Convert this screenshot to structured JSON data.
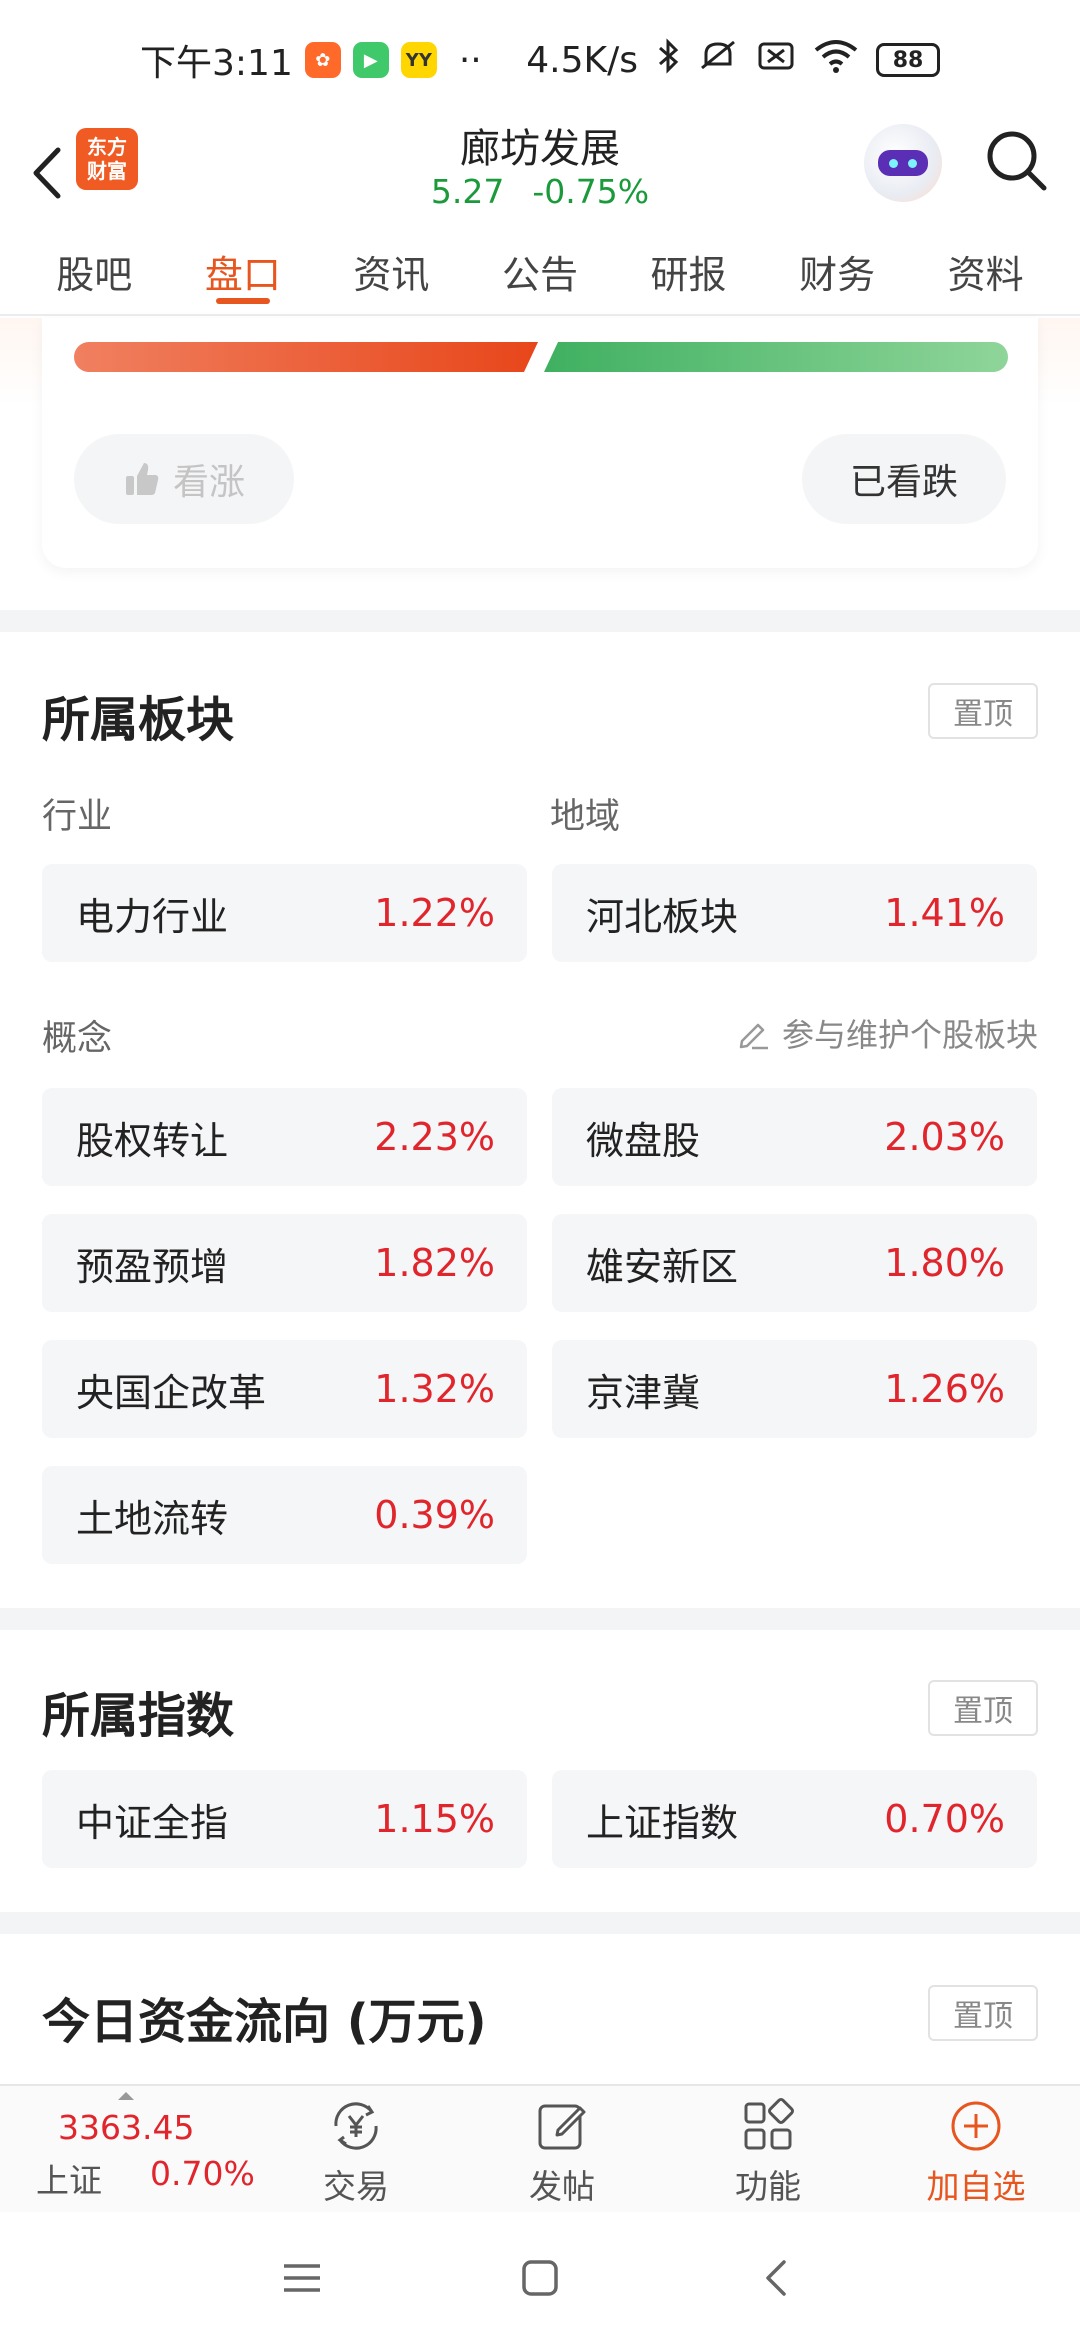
{
  "status_bar": {
    "time": "下午3:11",
    "network_speed": "4.5K/s",
    "battery": "88",
    "more_dots": "··"
  },
  "header": {
    "logo_line1": "东方",
    "logo_line2": "财富",
    "stock_name": "廊坊发展",
    "price": "5.27",
    "change_pct": "-0.75%"
  },
  "tabs": [
    {
      "label": "股吧"
    },
    {
      "label": "盘口"
    },
    {
      "label": "资讯"
    },
    {
      "label": "公告"
    },
    {
      "label": "研报"
    },
    {
      "label": "财务"
    },
    {
      "label": "资料"
    }
  ],
  "sentiment": {
    "bullish_fraction": 0.5,
    "up_label": "看涨",
    "down_label": "已看跌"
  },
  "sectors": {
    "title": "所属板块",
    "pin_label": "置顶",
    "industry_label": "行业",
    "region_label": "地域",
    "industry": {
      "name": "电力行业",
      "change": "1.22%"
    },
    "region": {
      "name": "河北板块",
      "change": "1.41%"
    },
    "concept_label": "概念",
    "maintain_label": "参与维护个股板块",
    "concepts": [
      {
        "name": "股权转让",
        "change": "2.23%"
      },
      {
        "name": "微盘股",
        "change": "2.03%"
      },
      {
        "name": "预盈预增",
        "change": "1.82%"
      },
      {
        "name": "雄安新区",
        "change": "1.80%"
      },
      {
        "name": "央国企改革",
        "change": "1.32%"
      },
      {
        "name": "京津冀",
        "change": "1.26%"
      },
      {
        "name": "土地流转",
        "change": "0.39%"
      }
    ]
  },
  "indices": {
    "title": "所属指数",
    "pin_label": "置顶",
    "items": [
      {
        "name": "中证全指",
        "change": "1.15%"
      },
      {
        "name": "上证指数",
        "change": "0.70%"
      }
    ]
  },
  "fund_flow": {
    "title": "今日资金流向 (万元)",
    "pin_label": "置顶"
  },
  "bottom_bar": {
    "index_value": "3363.45",
    "index_name": "上证",
    "index_change": "0.70%",
    "trade_label": "交易",
    "post_label": "发帖",
    "function_label": "功能",
    "add_watch_label": "加自选"
  },
  "colors": {
    "accent": "#e8561f",
    "rise": "#e0262c",
    "fall": "#1a9a3a"
  }
}
